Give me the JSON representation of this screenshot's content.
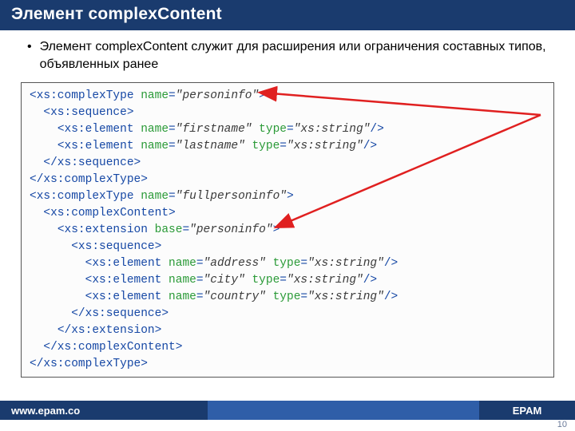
{
  "header": {
    "title": "Элемент complexContent"
  },
  "bullet": {
    "text": "Элемент complexContent служит для расширения или ограничения  составных типов, объявленных ранее"
  },
  "code": {
    "lines": [
      {
        "indent": 0,
        "tag_open": "<xs:complexType",
        "attrs": [
          [
            "name",
            "\"personinfo\""
          ]
        ],
        "end": ">"
      },
      {
        "indent": 1,
        "tag_open": "<xs:sequence>",
        "attrs": [],
        "end": ""
      },
      {
        "indent": 2,
        "tag_open": "<xs:element",
        "attrs": [
          [
            "name",
            "\"firstname\""
          ],
          [
            "type",
            "\"xs:string\""
          ]
        ],
        "end": "/>"
      },
      {
        "indent": 2,
        "tag_open": "<xs:element",
        "attrs": [
          [
            "name",
            "\"lastname\""
          ],
          [
            "type",
            "\"xs:string\""
          ]
        ],
        "end": "/>"
      },
      {
        "indent": 1,
        "tag_open": "</xs:sequence>",
        "attrs": [],
        "end": ""
      },
      {
        "indent": 0,
        "tag_open": "</xs:complexType>",
        "attrs": [],
        "end": ""
      },
      {
        "indent": 0,
        "tag_open": "<xs:complexType",
        "attrs": [
          [
            "name",
            "\"fullpersoninfo\""
          ]
        ],
        "end": ">"
      },
      {
        "indent": 1,
        "tag_open": "<xs:complexContent>",
        "attrs": [],
        "end": ""
      },
      {
        "indent": 2,
        "tag_open": "<xs:extension",
        "attrs": [
          [
            "base",
            "\"personinfo\""
          ]
        ],
        "end": ">"
      },
      {
        "indent": 3,
        "tag_open": "<xs:sequence>",
        "attrs": [],
        "end": ""
      },
      {
        "indent": 4,
        "tag_open": "<xs:element",
        "attrs": [
          [
            "name",
            "\"address\""
          ],
          [
            "type",
            "\"xs:string\""
          ]
        ],
        "end": "/>"
      },
      {
        "indent": 4,
        "tag_open": "<xs:element",
        "attrs": [
          [
            "name",
            "\"city\""
          ],
          [
            "type",
            "\"xs:string\""
          ]
        ],
        "end": "/>"
      },
      {
        "indent": 4,
        "tag_open": "<xs:element",
        "attrs": [
          [
            "name",
            "\"country\""
          ],
          [
            "type",
            "\"xs:string\""
          ]
        ],
        "end": "/>"
      },
      {
        "indent": 3,
        "tag_open": "</xs:sequence>",
        "attrs": [],
        "end": ""
      },
      {
        "indent": 2,
        "tag_open": "</xs:extension>",
        "attrs": [],
        "end": ""
      },
      {
        "indent": 1,
        "tag_open": "</xs:complexContent>",
        "attrs": [],
        "end": ""
      },
      {
        "indent": 0,
        "tag_open": "</xs:complexType>",
        "attrs": [],
        "end": ""
      }
    ]
  },
  "footer": {
    "url": "www.epam.co",
    "brand": "EPAM"
  },
  "page_number": "10"
}
